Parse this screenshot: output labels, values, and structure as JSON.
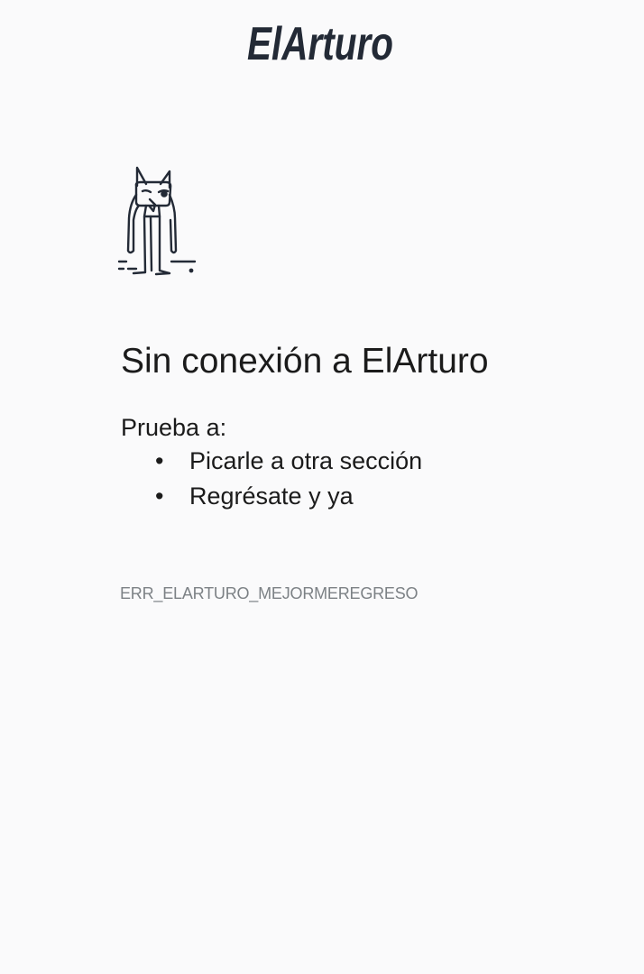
{
  "brand": {
    "logo_text": "ElArturo",
    "color": "#232a36"
  },
  "illustration": {
    "icon": "cat-character-icon"
  },
  "offline": {
    "title": "Sin conexión a ElArturo",
    "intro": "Prueba a:",
    "suggestions": [
      "Picarle a otra sección",
      "Regrésate y ya"
    ],
    "bullet": "•",
    "error_code": "ERR_ELARTURO_MEJORMEREGRESO"
  },
  "colors": {
    "background": "#fafafb",
    "text": "#1b1b1b",
    "muted": "#7c8185"
  }
}
